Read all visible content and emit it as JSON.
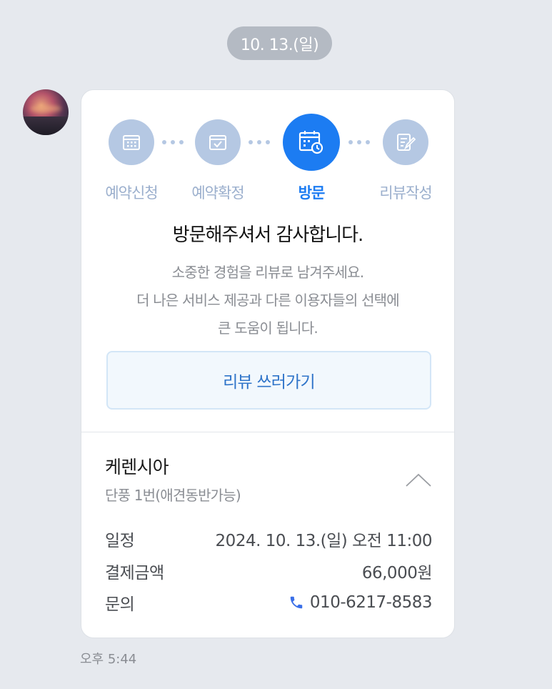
{
  "date_pill": "10. 13.(일)",
  "steps": [
    {
      "label": "예약신청",
      "icon": "calendar-grid-icon",
      "active": false
    },
    {
      "label": "예약확정",
      "icon": "calendar-check-icon",
      "active": false
    },
    {
      "label": "방문",
      "icon": "calendar-clock-icon",
      "active": true
    },
    {
      "label": "리뷰작성",
      "icon": "pencil-note-icon",
      "active": false
    }
  ],
  "card": {
    "title": "방문해주셔서 감사합니다.",
    "desc_line1": "소중한 경험을 리뷰로 남겨주세요.",
    "desc_line2": "더 나은 서비스 제공과 다른 이용자들의 선택에",
    "desc_line3": "큰 도움이 됩니다.",
    "review_button": "리뷰 쓰러가기"
  },
  "shop": {
    "name": "케렌시아",
    "sub": "단풍 1번(애견동반가능)",
    "schedule_label": "일정",
    "schedule_value": "2024. 10. 13.(일) 오전 11:00",
    "payment_label": "결제금액",
    "payment_value": "66,000원",
    "contact_label": "문의",
    "contact_value": "010-6217-8583"
  },
  "message_time": "오후 5:44",
  "colors": {
    "background": "#e6e9ee",
    "accent": "#1c7cf2",
    "inactive_step": "#b5c8e3",
    "button_text": "#2f74c9",
    "phone_icon": "#3a6fe8"
  }
}
